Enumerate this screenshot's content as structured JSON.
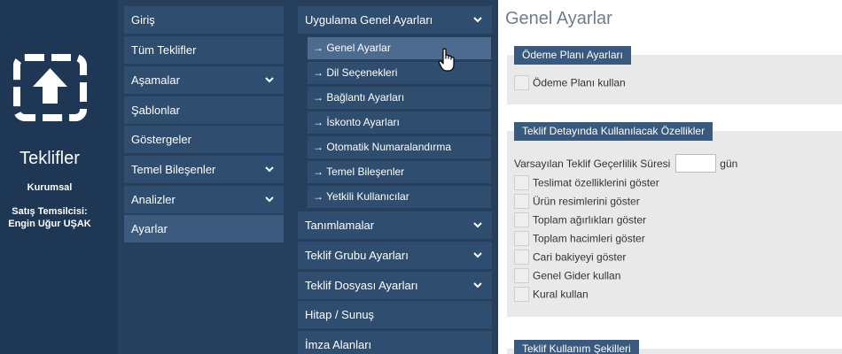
{
  "brand": {
    "app_title": "Teklifler",
    "subtitle": "Kurumsal",
    "rep_label": "Satış Temsilcisi:",
    "rep_name": "Engin Uğur UŞAK",
    "logo_icon": "upload-frame-icon"
  },
  "menu": {
    "items": [
      {
        "label": "Giriş",
        "has_children": false
      },
      {
        "label": "Tüm Teklifler",
        "has_children": false
      },
      {
        "label": "Aşamalar",
        "has_children": true
      },
      {
        "label": "Şablonlar",
        "has_children": false
      },
      {
        "label": "Göstergeler",
        "has_children": false
      },
      {
        "label": "Temel Bileşenler",
        "has_children": true
      },
      {
        "label": "Analizler",
        "has_children": true
      },
      {
        "label": "Ayarlar",
        "has_children": false,
        "active": true
      }
    ]
  },
  "submenu": {
    "group_title": "Uygulama Genel Ayarları",
    "sub_items": [
      "→ Genel Ayarlar",
      "→ Dil Seçenekleri",
      "→ Bağlantı Ayarları",
      "→ İskonto Ayarları",
      "→ Otomatik Numaralandırma",
      "→ Temel Bileşenler",
      "→ Yetkili Kullanıcılar"
    ],
    "active_sub_index": 0,
    "groups": [
      {
        "label": "Tanımlamalar",
        "has_children": true
      },
      {
        "label": "Teklif Grubu Ayarları",
        "has_children": true
      },
      {
        "label": "Teklif Dosyası Ayarları",
        "has_children": true
      },
      {
        "label": "Hitap / Sunuş",
        "has_children": false
      },
      {
        "label": "İmza Alanları",
        "has_children": false
      }
    ]
  },
  "content": {
    "page_title": "Genel Ayarlar",
    "panel1": {
      "title": "Ödeme Planı Ayarları",
      "options": [
        "Ödeme Planı kullan"
      ]
    },
    "panel2": {
      "title": "Teklif Detayında Kullanılacak Özellikler",
      "validity_label": "Varsayılan Teklif Geçerlilik Süresi",
      "validity_value": "",
      "validity_unit": "gün",
      "options": [
        "Teslimat özelliklerini göster",
        "Ürün resimlerini göster",
        "Toplam ağırlıkları göster",
        "Toplam hacimleri göster",
        "Cari bakiyeyi göster",
        "Genel Gider kullan",
        "Kural kullan"
      ]
    },
    "panel3": {
      "title": "Teklif Kullanım Şekilleri"
    }
  },
  "colors": {
    "brand_bg": "#1e3754",
    "menu_bg": "#263f5c",
    "menu_item_bg": "#2f4d6e",
    "panel_head_bg": "#395a7e",
    "panel_bg": "#e9e9e9"
  }
}
